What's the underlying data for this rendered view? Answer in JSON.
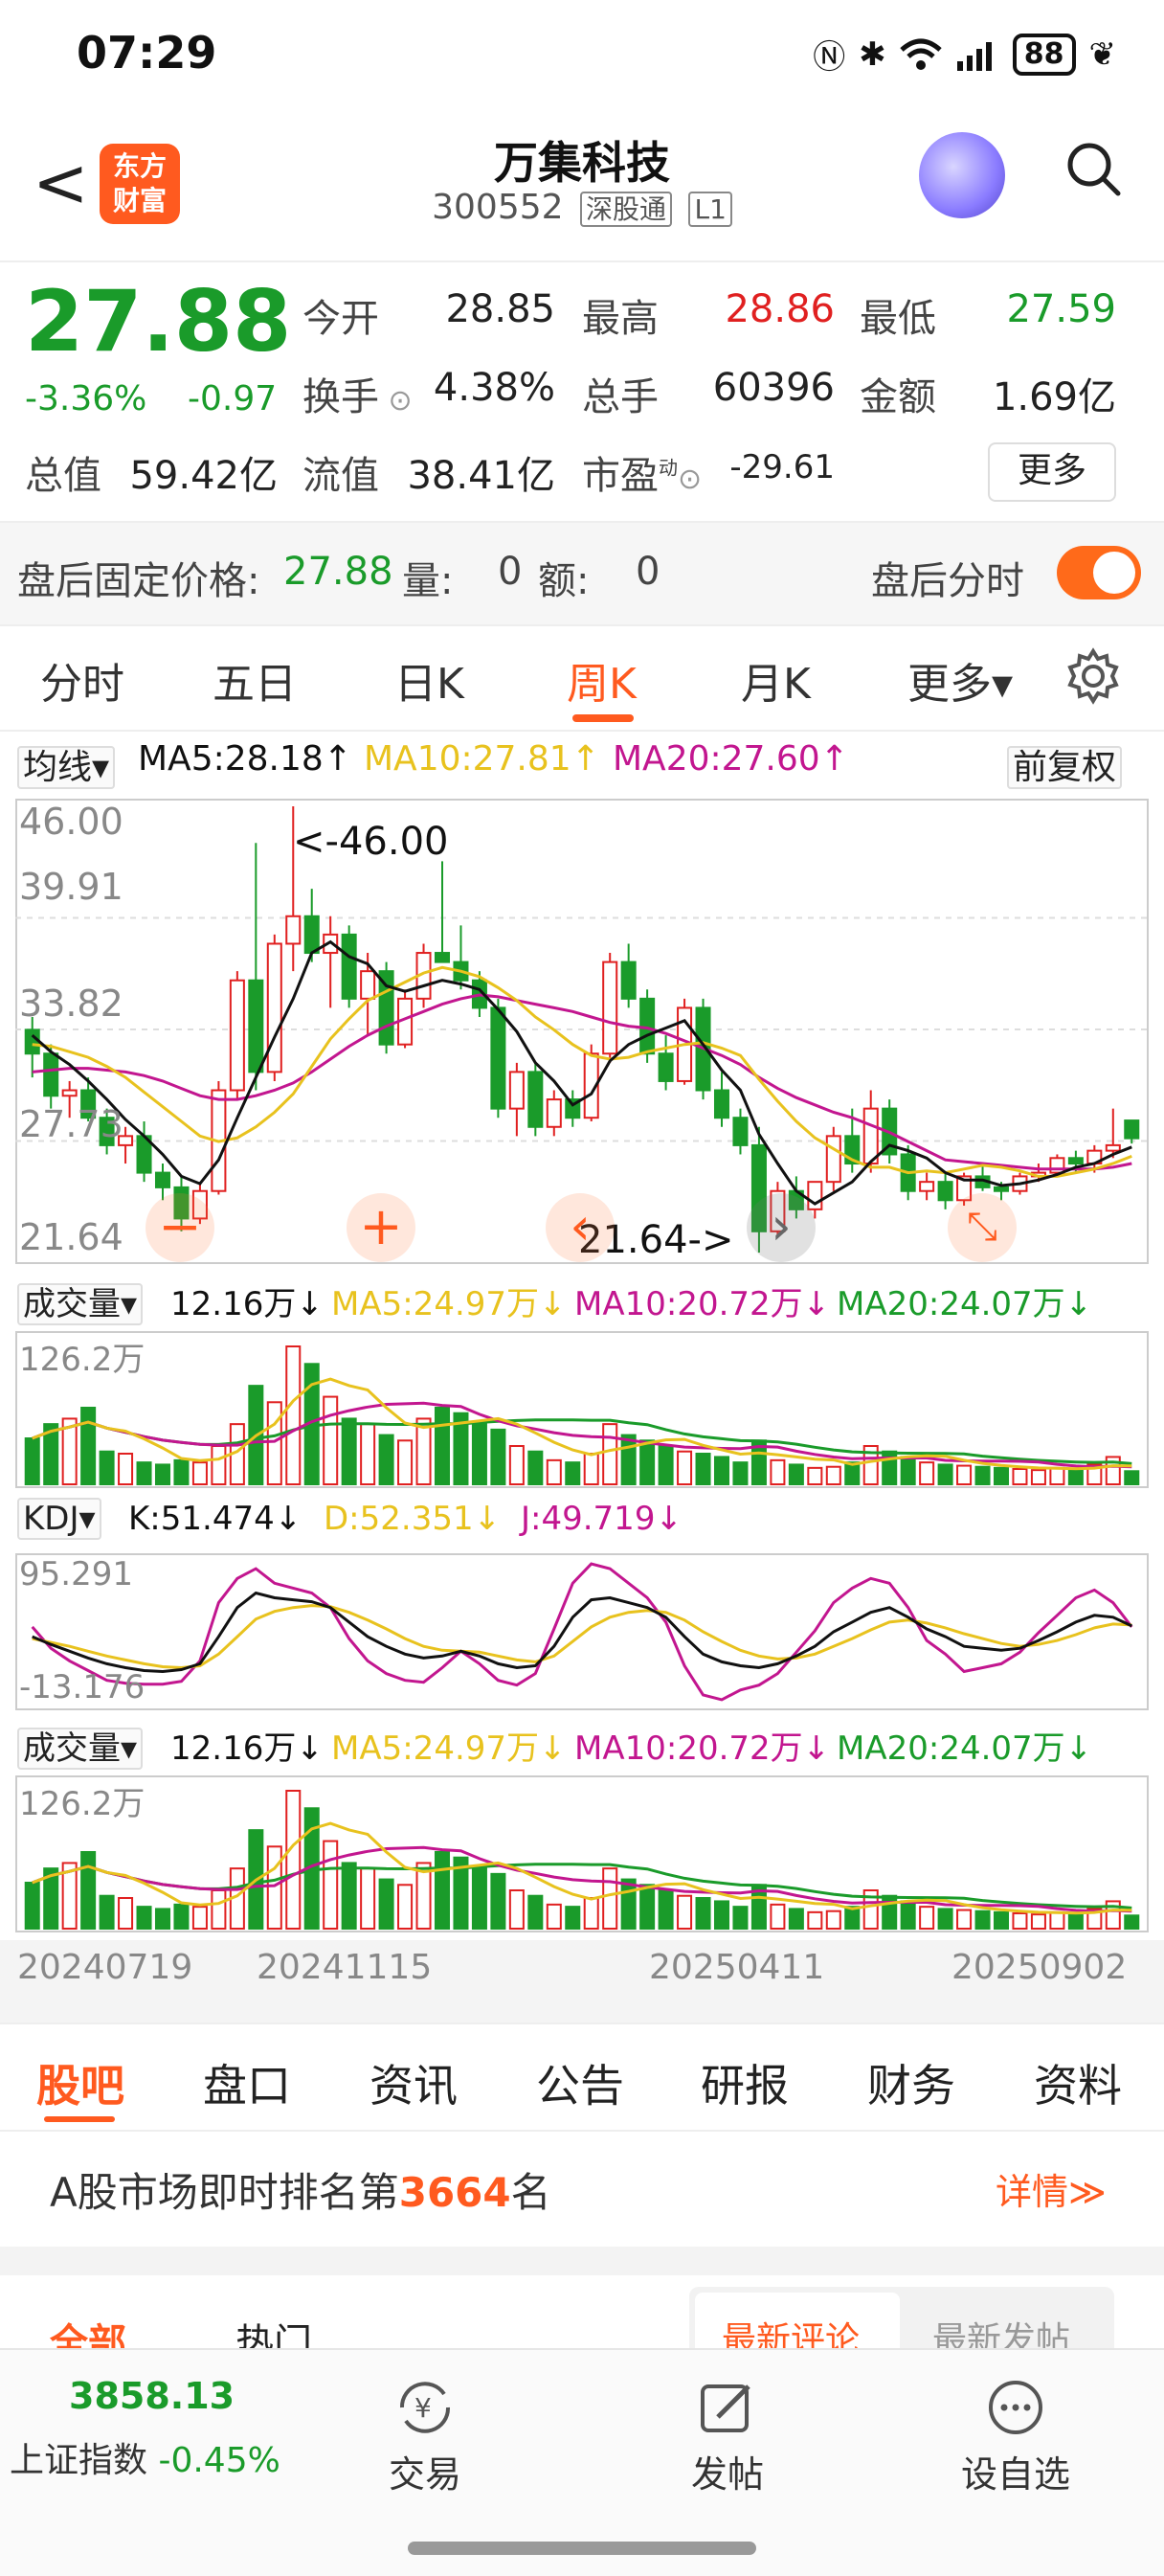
{
  "status_bar": {
    "time": "07:29",
    "battery": "88"
  },
  "header": {
    "back": "<",
    "logo_text": [
      "东方",
      "财富"
    ],
    "stock_name": "万集科技",
    "stock_code": "300552",
    "tag_market": "深股通",
    "tag_level": "L1"
  },
  "quote": {
    "price": "27.88",
    "change_pct": "-3.36%",
    "change": "-0.97",
    "open_label": "今开",
    "open": "28.85",
    "high_label": "最高",
    "high": "28.86",
    "low_label": "最低",
    "low": "27.59",
    "turnover_label": "换手",
    "turnover": "4.38%",
    "volume_label": "总手",
    "volume": "60396",
    "amount_label": "金额",
    "amount": "1.69亿",
    "mktcap_label": "总值",
    "mktcap": "59.42亿",
    "float_label": "流值",
    "float_cap": "38.41亿",
    "pe_label": "市盈",
    "pe_sup": "动",
    "pe": "-29.61",
    "more": "更多",
    "colors": {
      "up": "#e02020",
      "down": "#1a9b2a",
      "accent": "#ff5a1f"
    }
  },
  "after_hours": {
    "label": "盘后固定价格:",
    "price": "27.88",
    "vol_label": "量:",
    "vol": "0",
    "amt_label": "额:",
    "amt": "0",
    "toggle_label": "盘后分时"
  },
  "tabs": [
    "分时",
    "五日",
    "日K",
    "周K",
    "月K",
    "更多▾"
  ],
  "active_tab": "周K",
  "ma_legend": {
    "selector": "均线▾",
    "ma5": "MA5:28.18↑",
    "ma10": "MA10:27.81↑",
    "ma20": "MA20:27.60↑",
    "adjust": "前复权"
  },
  "chart_data": [
    {
      "type": "candlestick",
      "title": "",
      "y_ticks": [
        "46.00",
        "39.91",
        "33.82",
        "27.73",
        "21.64"
      ],
      "ylim": [
        21.64,
        46.0
      ],
      "annotations": [
        "<-46.00",
        "21.64->"
      ],
      "series_names": [
        "MA5",
        "MA10",
        "MA20"
      ],
      "ohlc": [
        [
          33.8,
          34.5,
          31.2,
          32.5
        ],
        [
          32.5,
          33.0,
          29.5,
          30.2
        ],
        [
          30.2,
          31.0,
          29.0,
          30.5
        ],
        [
          30.5,
          31.2,
          28.8,
          29.0
        ],
        [
          29.0,
          29.5,
          27.0,
          27.5
        ],
        [
          27.5,
          28.5,
          26.5,
          28.0
        ],
        [
          28.0,
          28.8,
          25.5,
          26.0
        ],
        [
          26.0,
          26.5,
          24.5,
          25.2
        ],
        [
          25.2,
          25.8,
          22.8,
          23.5
        ],
        [
          23.5,
          25.5,
          23.2,
          25.0
        ],
        [
          25.0,
          31.0,
          24.8,
          30.5
        ],
        [
          30.5,
          37.0,
          30.0,
          36.5
        ],
        [
          36.5,
          44.0,
          30.5,
          31.5
        ],
        [
          31.5,
          39.0,
          31.0,
          38.5
        ],
        [
          38.5,
          46.0,
          37.0,
          40.0
        ],
        [
          40.0,
          41.5,
          37.5,
          38.0
        ],
        [
          38.0,
          40.0,
          35.0,
          39.0
        ],
        [
          39.0,
          39.5,
          35.0,
          35.5
        ],
        [
          35.5,
          38.0,
          33.5,
          37.0
        ],
        [
          37.0,
          37.5,
          32.5,
          33.0
        ],
        [
          33.0,
          36.0,
          32.8,
          35.5
        ],
        [
          35.5,
          38.5,
          35.0,
          38.0
        ],
        [
          38.0,
          43.0,
          37.5,
          37.5
        ],
        [
          37.5,
          39.5,
          36.0,
          36.5
        ],
        [
          36.5,
          37.0,
          34.5,
          35.0
        ],
        [
          35.0,
          35.5,
          29.0,
          29.5
        ],
        [
          29.5,
          32.0,
          28.0,
          31.5
        ],
        [
          31.5,
          32.0,
          28.0,
          28.5
        ],
        [
          28.5,
          30.5,
          28.0,
          30.0
        ],
        [
          30.0,
          30.5,
          28.5,
          29.0
        ],
        [
          29.0,
          33.0,
          28.8,
          32.5
        ],
        [
          32.5,
          38.0,
          32.0,
          37.5
        ],
        [
          37.5,
          38.5,
          35.0,
          35.5
        ],
        [
          35.5,
          36.0,
          32.0,
          32.5
        ],
        [
          32.5,
          33.5,
          30.5,
          31.0
        ],
        [
          31.0,
          35.5,
          30.8,
          35.0
        ],
        [
          35.0,
          35.5,
          30.0,
          30.5
        ],
        [
          30.5,
          31.5,
          28.5,
          29.0
        ],
        [
          29.0,
          29.5,
          27.0,
          27.5
        ],
        [
          27.5,
          28.5,
          21.64,
          22.8
        ],
        [
          22.8,
          25.5,
          22.5,
          25.0
        ],
        [
          25.0,
          25.8,
          23.5,
          24.0
        ],
        [
          24.0,
          25.5,
          23.5,
          25.5
        ],
        [
          25.5,
          28.5,
          25.0,
          28.0
        ],
        [
          28.0,
          29.5,
          26.0,
          26.5
        ],
        [
          26.5,
          30.5,
          26.0,
          29.5
        ],
        [
          29.5,
          30.0,
          26.5,
          27.0
        ],
        [
          27.0,
          27.5,
          24.5,
          25.0
        ],
        [
          25.0,
          26.0,
          24.5,
          25.5
        ],
        [
          25.5,
          26.0,
          24.0,
          24.5
        ],
        [
          24.5,
          26.0,
          24.2,
          25.8
        ],
        [
          25.8,
          26.5,
          25.0,
          25.2
        ],
        [
          25.2,
          25.5,
          24.5,
          25.0
        ],
        [
          25.0,
          26.0,
          24.8,
          25.8
        ],
        [
          25.8,
          26.5,
          25.5,
          26.0
        ],
        [
          26.0,
          27.0,
          25.8,
          26.8
        ],
        [
          26.8,
          27.2,
          26.0,
          26.5
        ],
        [
          26.5,
          27.5,
          26.0,
          27.2
        ],
        [
          27.2,
          29.5,
          26.8,
          27.5
        ],
        [
          28.85,
          28.86,
          27.59,
          27.88
        ]
      ],
      "ma5": [
        33.5,
        32.6,
        31.9,
        31.0,
        30.0,
        28.9,
        28.0,
        27.0,
        25.8,
        25.4,
        26.7,
        29.0,
        31.2,
        33.4,
        35.5,
        38.0,
        38.6,
        37.8,
        37.4,
        36.2,
        35.9,
        36.2,
        36.5,
        36.3,
        36.0,
        34.9,
        33.7,
        32.0,
        31.0,
        29.7,
        30.3,
        32.1,
        33.0,
        33.5,
        33.9,
        34.3,
        33.0,
        31.6,
        30.5,
        28.1,
        26.5,
        25.0,
        24.3,
        24.9,
        25.5,
        26.6,
        27.5,
        27.2,
        26.8,
        26.0,
        25.6,
        25.6,
        25.3,
        25.4,
        25.6,
        25.9,
        26.3,
        26.5,
        27.0,
        27.4
      ],
      "ma10": [
        33.0,
        32.9,
        32.6,
        32.3,
        31.8,
        31.2,
        30.4,
        29.6,
        28.8,
        28.0,
        27.7,
        27.9,
        28.5,
        29.3,
        30.3,
        31.8,
        33.3,
        34.4,
        35.4,
        35.9,
        36.4,
        36.9,
        37.2,
        37.0,
        36.7,
        36.1,
        35.4,
        34.5,
        33.8,
        33.0,
        32.4,
        32.2,
        32.3,
        32.6,
        32.8,
        33.0,
        33.1,
        32.8,
        32.4,
        31.1,
        29.9,
        28.8,
        27.9,
        27.3,
        26.7,
        26.3,
        26.3,
        26.0,
        26.1,
        26.0,
        26.2,
        26.4,
        26.3,
        26.1,
        25.8,
        25.8,
        26.0,
        26.2,
        26.5,
        26.9
      ],
      "ma20": [
        31.5,
        31.6,
        31.7,
        31.7,
        31.6,
        31.5,
        31.3,
        31.0,
        30.6,
        30.2,
        30.0,
        30.0,
        30.2,
        30.5,
        30.9,
        31.5,
        32.2,
        32.9,
        33.5,
        34.0,
        34.4,
        34.8,
        35.2,
        35.5,
        35.7,
        35.6,
        35.4,
        35.2,
        35.0,
        34.8,
        34.5,
        34.2,
        34.0,
        33.9,
        33.6,
        33.2,
        32.8,
        32.4,
        31.9,
        31.2,
        30.6,
        30.1,
        29.7,
        29.3,
        29.0,
        28.6,
        28.2,
        27.7,
        27.2,
        26.7,
        26.6,
        26.5,
        26.4,
        26.3,
        26.2,
        26.2,
        26.2,
        26.2,
        26.3,
        26.5
      ]
    },
    {
      "type": "bar",
      "title": "成交量",
      "legend": {
        "selector": "成交量▾",
        "vol": "12.16万↓",
        "ma5": "MA5:24.97万↓",
        "ma10": "MA10:20.72万↓",
        "ma20": "MA20:24.07万↓"
      },
      "y_max_label": "126.2万",
      "values": [
        42,
        55,
        60,
        70,
        30,
        28,
        20,
        18,
        22,
        20,
        35,
        55,
        90,
        75,
        126,
        110,
        80,
        60,
        55,
        45,
        40,
        60,
        70,
        65,
        55,
        50,
        35,
        30,
        22,
        20,
        28,
        55,
        45,
        40,
        35,
        30,
        28,
        25,
        20,
        40,
        22,
        18,
        15,
        16,
        20,
        35,
        30,
        25,
        20,
        18,
        17,
        16,
        15,
        14,
        13,
        15,
        14,
        18,
        25,
        12
      ]
    },
    {
      "type": "line",
      "title": "KDJ",
      "legend": {
        "selector": "KDJ▾",
        "k": "K:51.474↓",
        "d": "D:52.351↓",
        "j": "J:49.719↓"
      },
      "y_ticks": [
        "95.291",
        "-13.176"
      ],
      "ylim": [
        -13.176,
        95.291
      ],
      "k": [
        40,
        32,
        25,
        18,
        12,
        8,
        5,
        4,
        6,
        12,
        40,
        70,
        85,
        80,
        78,
        76,
        70,
        55,
        40,
        30,
        22,
        18,
        20,
        25,
        20,
        12,
        8,
        10,
        30,
        60,
        78,
        80,
        75,
        70,
        60,
        40,
        22,
        14,
        10,
        8,
        12,
        20,
        30,
        45,
        55,
        65,
        70,
        60,
        48,
        40,
        30,
        28,
        26,
        28,
        36,
        45,
        55,
        62,
        60,
        51
      ],
      "d": [
        38,
        34,
        30,
        25,
        20,
        16,
        12,
        9,
        8,
        10,
        22,
        40,
        58,
        66,
        70,
        72,
        71,
        65,
        57,
        48,
        38,
        30,
        26,
        25,
        24,
        20,
        16,
        14,
        20,
        35,
        50,
        60,
        65,
        67,
        65,
        57,
        45,
        35,
        26,
        20,
        17,
        18,
        22,
        30,
        38,
        47,
        55,
        57,
        54,
        49,
        43,
        38,
        33,
        30,
        32,
        36,
        42,
        49,
        53,
        52
      ],
      "j": [
        50,
        28,
        15,
        5,
        -5,
        -8,
        -9,
        -9,
        -6,
        15,
        75,
        100,
        110,
        95,
        90,
        85,
        70,
        38,
        15,
        2,
        -5,
        -7,
        8,
        25,
        12,
        -5,
        -10,
        2,
        48,
        95,
        115,
        110,
        95,
        80,
        55,
        10,
        -20,
        -25,
        -15,
        -10,
        2,
        24,
        46,
        75,
        90,
        100,
        95,
        70,
        36,
        22,
        4,
        8,
        12,
        24,
        44,
        62,
        80,
        88,
        75,
        50
      ]
    },
    {
      "type": "bar",
      "title": "成交量",
      "legend": {
        "selector": "成交量▾",
        "vol": "12.16万↓",
        "ma5": "MA5:24.97万↓",
        "ma10": "MA10:20.72万↓",
        "ma20": "MA20:24.07万↓"
      },
      "y_max_label": "126.2万",
      "x_ticks": [
        "20240719",
        "20241115",
        "20250411",
        "20250902"
      ]
    }
  ],
  "chart_controls": [
    "zoom-out",
    "zoom-in",
    "prev",
    "next",
    "collapse"
  ],
  "lower_tabs": [
    "股吧",
    "盘口",
    "资讯",
    "公告",
    "研报",
    "财务",
    "资料"
  ],
  "active_lower_tab": "股吧",
  "rank": {
    "prefix": "A股市场即时排名第",
    "rank": "3664",
    "suffix": "名",
    "details": "详情≫"
  },
  "forum": {
    "tab_all": "全部",
    "tab_hot": "热门",
    "sort_latest_comment": "最新评论",
    "sort_latest_post": "最新发帖"
  },
  "bottom_nav": {
    "index_value": "3858.13",
    "index_name": "上证指数",
    "index_change": "-0.45%",
    "trade": "交易",
    "post": "发帖",
    "watchlist": "设自选"
  }
}
